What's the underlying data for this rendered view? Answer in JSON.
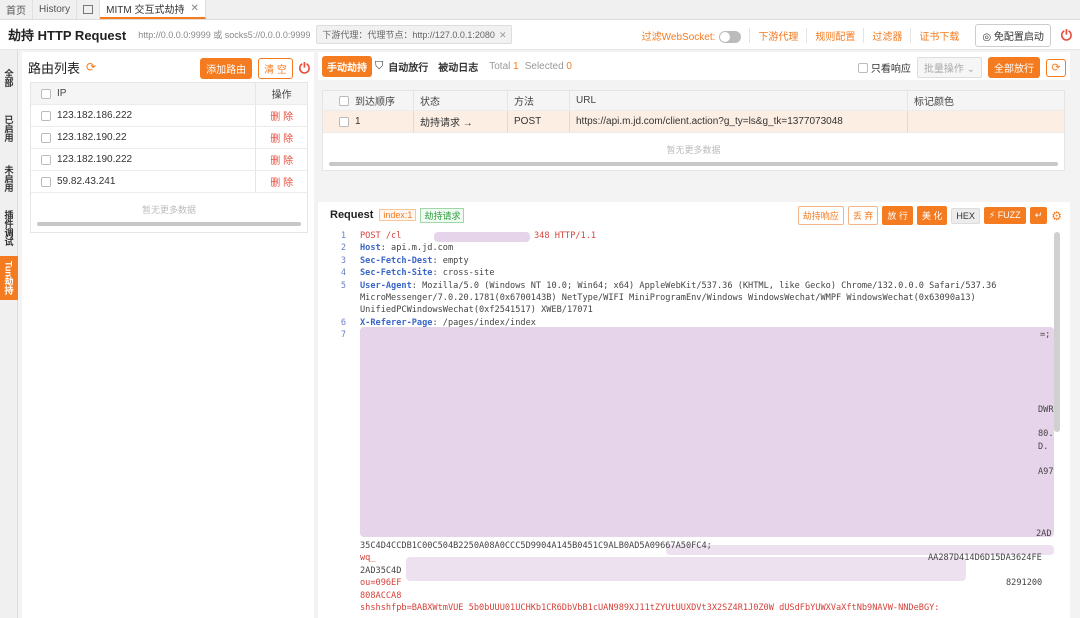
{
  "tabs": [
    {
      "label": "首页"
    },
    {
      "label": "History"
    },
    {
      "label": "MITM 交互式劫持",
      "active": true
    }
  ],
  "header": {
    "title": "劫持 HTTP Request",
    "address": "http://0.0.0.0:9999 或 socks5://0.0.0.0:9999",
    "proxy_tag": "下游代理：代理节点：http://127.0.0.1:2080",
    "filter_ws": "过滤WebSocket:",
    "links": [
      "下游代理",
      "规则配置",
      "过滤器",
      "证书下载"
    ],
    "one_click": "免配置启动"
  },
  "vtabs": [
    "全部",
    "已启用",
    "未启用",
    "插件调试",
    "Tun劫持"
  ],
  "route_panel": {
    "title": "路由列表",
    "add_btn": "添加路由",
    "clear_btn": "清 空",
    "col_ip": "IP",
    "col_op": "操作",
    "rows": [
      {
        "ip": "123.182.186.222",
        "op": "删 除"
      },
      {
        "ip": "123.182.190.22",
        "op": "删 除"
      },
      {
        "ip": "123.182.190.222",
        "op": "删 除"
      },
      {
        "ip": "59.82.43.241",
        "op": "删 除"
      }
    ],
    "empty": "暂无更多数据"
  },
  "toolbar": {
    "manual": "手动劫持",
    "auto": "自动放行",
    "passive": "被动日志",
    "total_label": "Total",
    "total": "1",
    "selected_label": "Selected",
    "selected": "0",
    "only_resp": "只看响应",
    "batch": "批量操作",
    "release_all": "全部放行"
  },
  "packet_table": {
    "cols": [
      "到达顺序",
      "状态",
      "方法",
      "URL",
      "标记颜色"
    ],
    "rows": [
      {
        "order": "1",
        "status": "劫持请求 →",
        "method": "POST",
        "url": "https://api.m.jd.com/client.action?g_ty=ls&g_tk=1377073048",
        "color": ""
      }
    ],
    "empty": "暂无更多数据"
  },
  "request": {
    "title": "Request",
    "index_tag": "index:1",
    "status_tag": "劫持请求",
    "buttons": [
      "劫持响应",
      "丢 弃",
      "放 行",
      "美 化",
      "HEX",
      "FUZZ"
    ],
    "lines": [
      {
        "n": "1",
        "text": "POST /cl",
        "tail": "348 HTTP/1.1"
      },
      {
        "n": "2",
        "key": "Host",
        "text": ": api.m.jd.com"
      },
      {
        "n": "3",
        "key": "Sec-Fetch-Dest",
        "text": ": empty"
      },
      {
        "n": "4",
        "key": "Sec-Fetch-Site",
        "text": ": cross-site"
      },
      {
        "n": "5",
        "key": "User-Agent",
        "text": ": Mozilla/5.0 (Windows NT 10.0; Win64; x64) AppleWebKit/537.36 (KHTML, like Gecko) Chrome/132.0.0.0 Safari/537.36"
      },
      {
        "n": "",
        "text": "MicroMessenger/7.0.20.1781(0x6700143B) NetType/WIFI MiniProgramEnv/Windows WindowsWechat/WMPF WindowsWechat(0x63090a13)"
      },
      {
        "n": "",
        "text": "UnifiedPCWindowsWechat(0xf2541517) XWEB/17071"
      },
      {
        "n": "6",
        "key": "X-Referer-Page",
        "text": ": /pages/index/index"
      },
      {
        "n": "7",
        "text": ""
      }
    ],
    "tail_lines": [
      "35C4D4CCDB1C00C504B2250A08A0CCC5D9904A145B0451C9ALB0AD5A09667A50FC4;",
      "wq_",
      "2AD35C4D",
      "ou=096EF",
      "808ACCA8",
      "shshshfpb=BABXWtmVUE 5b0bUUU01UCHKb1CR6DbVbB1cUAN989XJ11tZYUtUUXDVt3X2SZ4R1J0Z0W dUSdFbYUWXVaXftNb9NAVW-NNDeBGY:"
    ],
    "right_frags": [
      "AA287D414D6D15DA3624FE",
      "8291200",
      "DWR",
      "80.",
      "D.",
      "A97",
      "2AD",
      "=;"
    ]
  }
}
